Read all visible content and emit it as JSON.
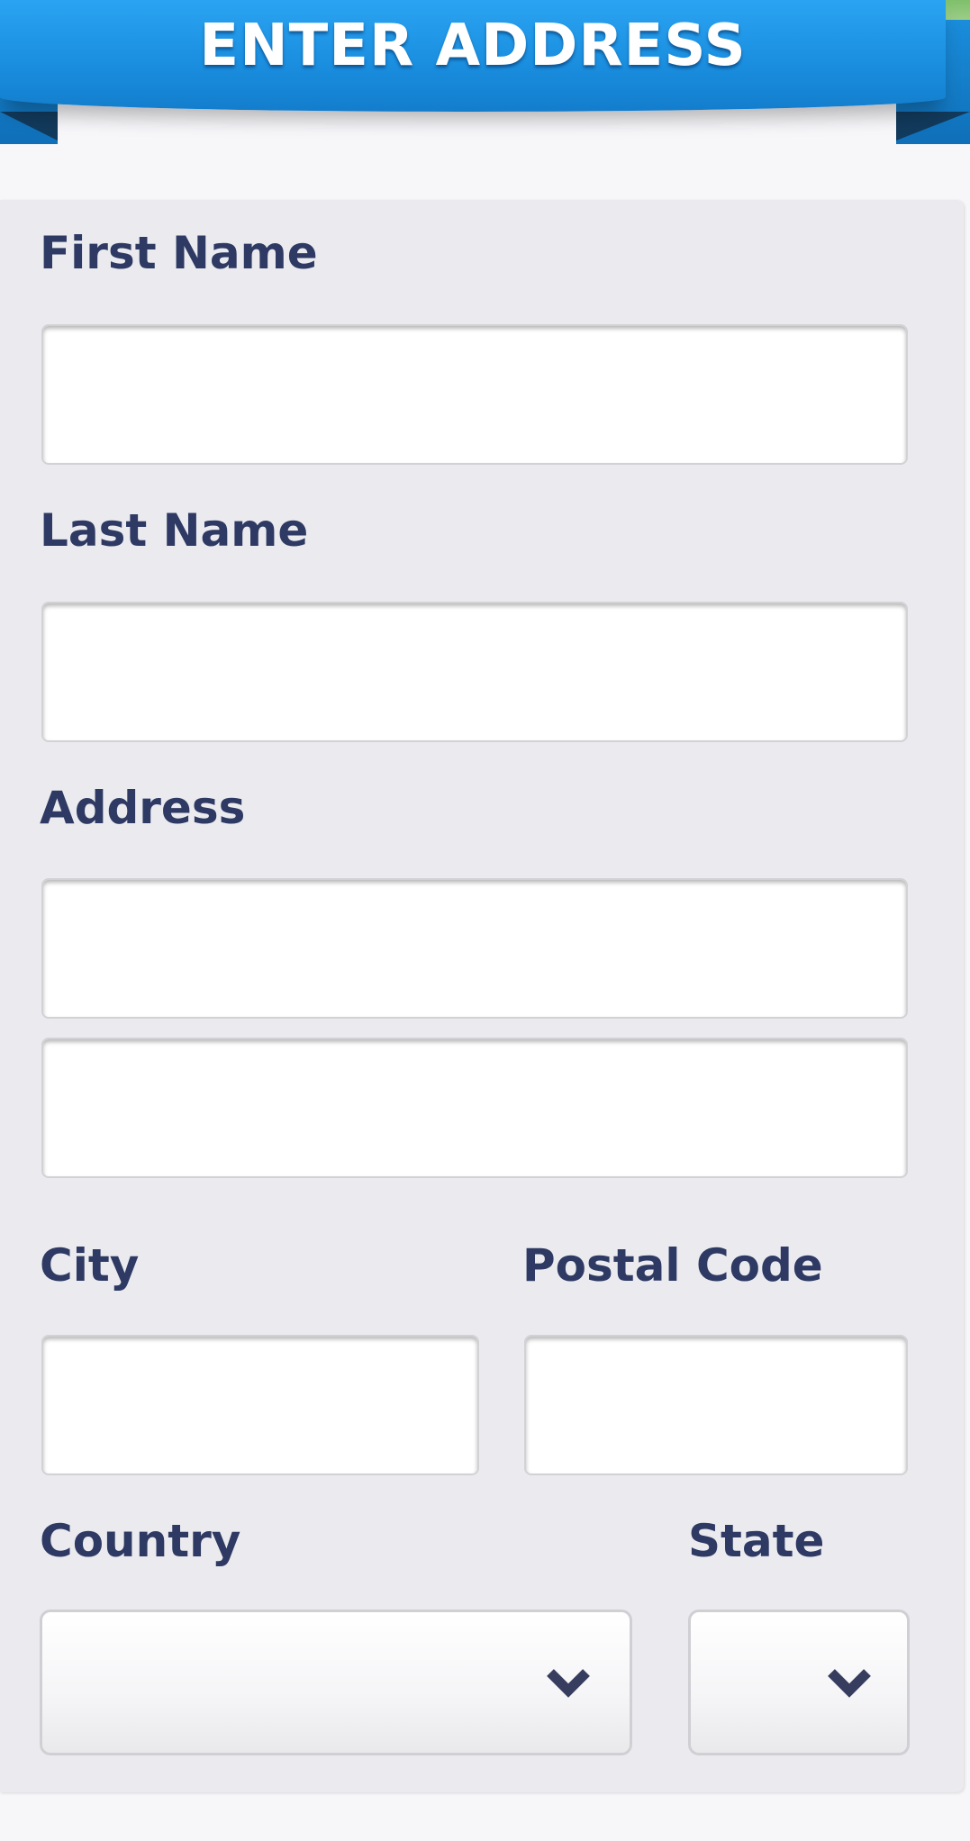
{
  "header": {
    "title": "ENTER ADDRESS"
  },
  "form": {
    "first_name": {
      "label": "First Name",
      "value": "",
      "placeholder": ""
    },
    "last_name": {
      "label": "Last Name",
      "value": "",
      "placeholder": ""
    },
    "address": {
      "label": "Address",
      "line1": {
        "value": "",
        "placeholder": ""
      },
      "line2": {
        "value": "",
        "placeholder": ""
      }
    },
    "city": {
      "label": "City",
      "value": "",
      "placeholder": ""
    },
    "postal_code": {
      "label": "Postal Code",
      "value": "",
      "placeholder": ""
    },
    "country": {
      "label": "Country",
      "selected": "",
      "icon": "chevron-down-icon"
    },
    "state": {
      "label": "State",
      "selected": "",
      "icon": "chevron-down-icon"
    }
  },
  "colors": {
    "banner_blue": "#1b8fe0",
    "label_navy": "#2e3a63",
    "card_background": "#ebebef",
    "page_background": "#f7f7fa"
  }
}
